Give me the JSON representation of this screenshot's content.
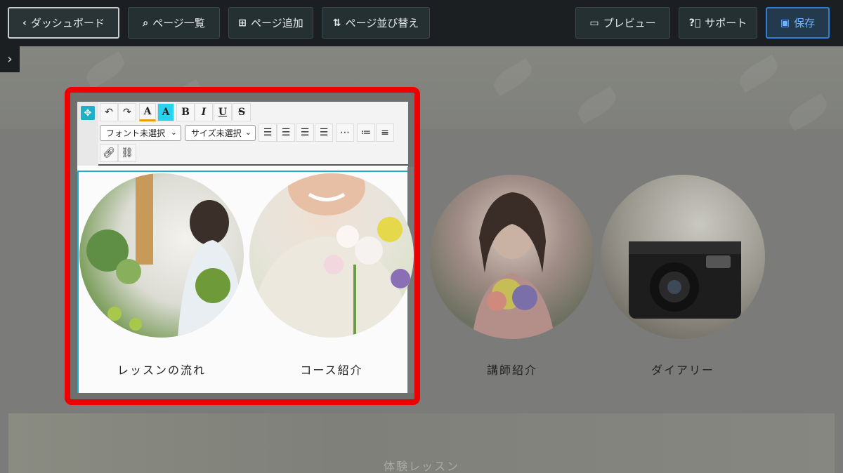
{
  "topbar": {
    "dashboard_label": "ダッシュボード",
    "page_list_label": "ページ一覧",
    "add_page_label": "ページ追加",
    "reorder_label": "ページ並び替え",
    "preview_label": "プレビュー",
    "support_label": "サポート",
    "save_label": "保存"
  },
  "editor_toolbar": {
    "font_select": "フォント未選択",
    "size_select": "サイズ未選択",
    "forecolor_label": "A",
    "backcolor_label": "A",
    "bold_label": "B",
    "italic_label": "I",
    "underline_label": "U",
    "strike_label": "S"
  },
  "menu_items": [
    {
      "label": "レッスンの流れ"
    },
    {
      "label": "コース紹介"
    },
    {
      "label": "講師紹介"
    },
    {
      "label": "ダイアリー"
    }
  ],
  "bottom_section": {
    "title": "体験レッスン"
  },
  "colors": {
    "accent": "#1fb0c8",
    "highlight_frame": "#ee0000",
    "save": "#2f7fd6"
  }
}
